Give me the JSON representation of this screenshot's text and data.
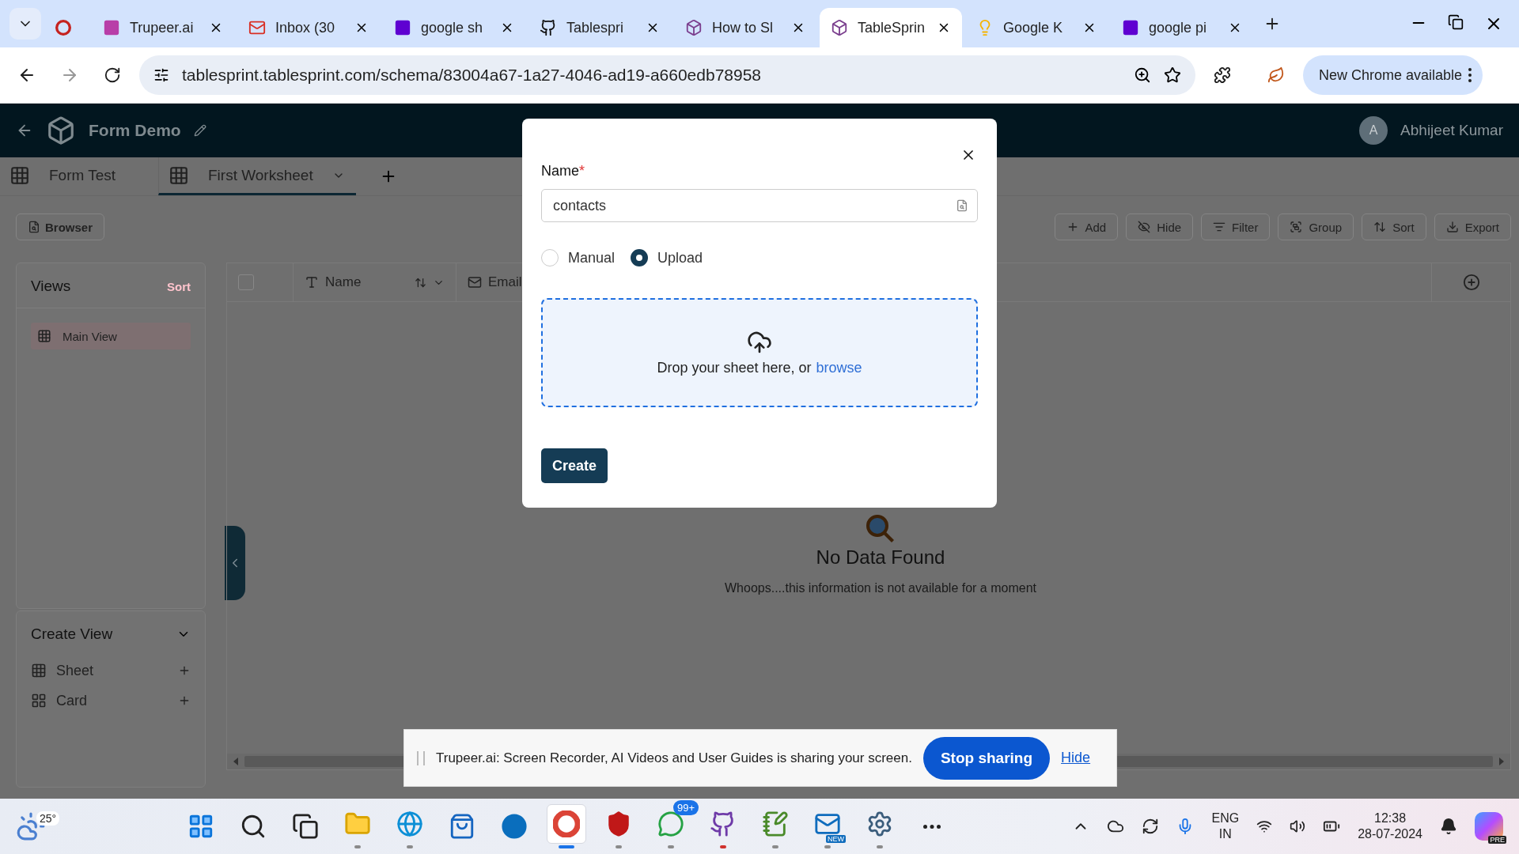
{
  "browser": {
    "tabs": [
      {
        "kind": "recording",
        "selected": false
      },
      {
        "kind": "trupeer",
        "title": "Trupeer.ai",
        "selected": false
      },
      {
        "kind": "mail",
        "title": "Inbox (30",
        "selected": false
      },
      {
        "kind": "yahoo",
        "title": "google sh",
        "selected": false
      },
      {
        "kind": "github",
        "title": "Tablespri",
        "selected": false
      },
      {
        "kind": "cube",
        "title": "How to Sl",
        "selected": false
      },
      {
        "kind": "cube",
        "title": "TableSprin",
        "selected": true
      },
      {
        "kind": "keep",
        "title": "Google K",
        "selected": false
      },
      {
        "kind": "yahoo",
        "title": "google pi",
        "selected": false
      }
    ],
    "url": "tablesprint.tablesprint.com/schema/83004a67-1a27-4046-ad19-a660edb78958",
    "update": "New Chrome available"
  },
  "app": {
    "title": "Form Demo",
    "user": {
      "initial": "A",
      "name": "Abhijeet Kumar"
    },
    "sheet_tabs": [
      {
        "label": "Form Test",
        "selected": false
      },
      {
        "label": "First Worksheet",
        "selected": true
      }
    ],
    "browser_button": "Browser",
    "select_all": {
      "checked": false
    },
    "views": {
      "title": "Views",
      "sort": "Sort",
      "items": [
        {
          "label": "Main View",
          "selected": true
        }
      ]
    },
    "create_view": {
      "title": "Create View",
      "expanded": true,
      "items": [
        {
          "kind": "sheet",
          "label": "Sheet"
        },
        {
          "kind": "card",
          "label": "Card"
        }
      ]
    },
    "toolbar": [
      {
        "kind": "add",
        "label": "Add"
      },
      {
        "kind": "hide",
        "label": "Hide"
      },
      {
        "kind": "filter",
        "label": "Filter"
      },
      {
        "kind": "group",
        "label": "Group"
      },
      {
        "kind": "sort",
        "label": "Sort"
      },
      {
        "kind": "export",
        "label": "Export"
      }
    ],
    "columns": [
      {
        "kind": "text",
        "label": "Name"
      },
      {
        "kind": "email",
        "label": "Email"
      }
    ],
    "empty": {
      "title": "No Data Found",
      "message": "Whoops....this information is not available for a moment"
    }
  },
  "modal": {
    "name_label": "Name",
    "required_mark": "*",
    "name_value": "contacts",
    "modes": [
      {
        "label": "Manual",
        "selected": false
      },
      {
        "label": "Upload",
        "selected": true
      }
    ],
    "drop_text": "Drop your sheet here, or",
    "browse": "browse",
    "create": "Create"
  },
  "share_bar": {
    "message": "Trupeer.ai: Screen Recorder, AI Videos and User Guides is sharing your screen.",
    "stop": "Stop sharing",
    "hide": "Hide"
  },
  "taskbar": {
    "weather": "25°",
    "apps": [
      {
        "kind": "start",
        "running": false,
        "active": false
      },
      {
        "kind": "search",
        "running": false,
        "active": false
      },
      {
        "kind": "taskview",
        "running": false,
        "active": false
      },
      {
        "kind": "folder",
        "running": true,
        "active": false,
        "color": "#8a8a8a"
      },
      {
        "kind": "edge",
        "running": true,
        "active": false,
        "color": "#8a8a8a"
      },
      {
        "kind": "store",
        "running": false,
        "active": false
      },
      {
        "kind": "dell",
        "running": false,
        "active": false
      },
      {
        "kind": "chrome",
        "running": true,
        "active": true,
        "color": "#1a73e8"
      },
      {
        "kind": "shield",
        "running": true,
        "active": false,
        "color": "#8a8a8a"
      },
      {
        "kind": "whatsapp",
        "running": true,
        "active": false,
        "color": "#8a8a8a",
        "badge": "99+"
      },
      {
        "kind": "github",
        "running": true,
        "active": false,
        "color": "#d0312d"
      },
      {
        "kind": "notes",
        "running": true,
        "active": false,
        "color": "#8a8a8a"
      },
      {
        "kind": "outlook",
        "running": true,
        "active": false,
        "color": "#8a8a8a",
        "badge": "NEW"
      },
      {
        "kind": "settings",
        "running": true,
        "active": false,
        "color": "#8a8a8a"
      },
      {
        "kind": "more",
        "running": false,
        "active": false
      }
    ],
    "lang": "ENG",
    "region": "IN",
    "time": "12:38",
    "date": "28-07-2024",
    "copilot_badge": "PRE"
  }
}
